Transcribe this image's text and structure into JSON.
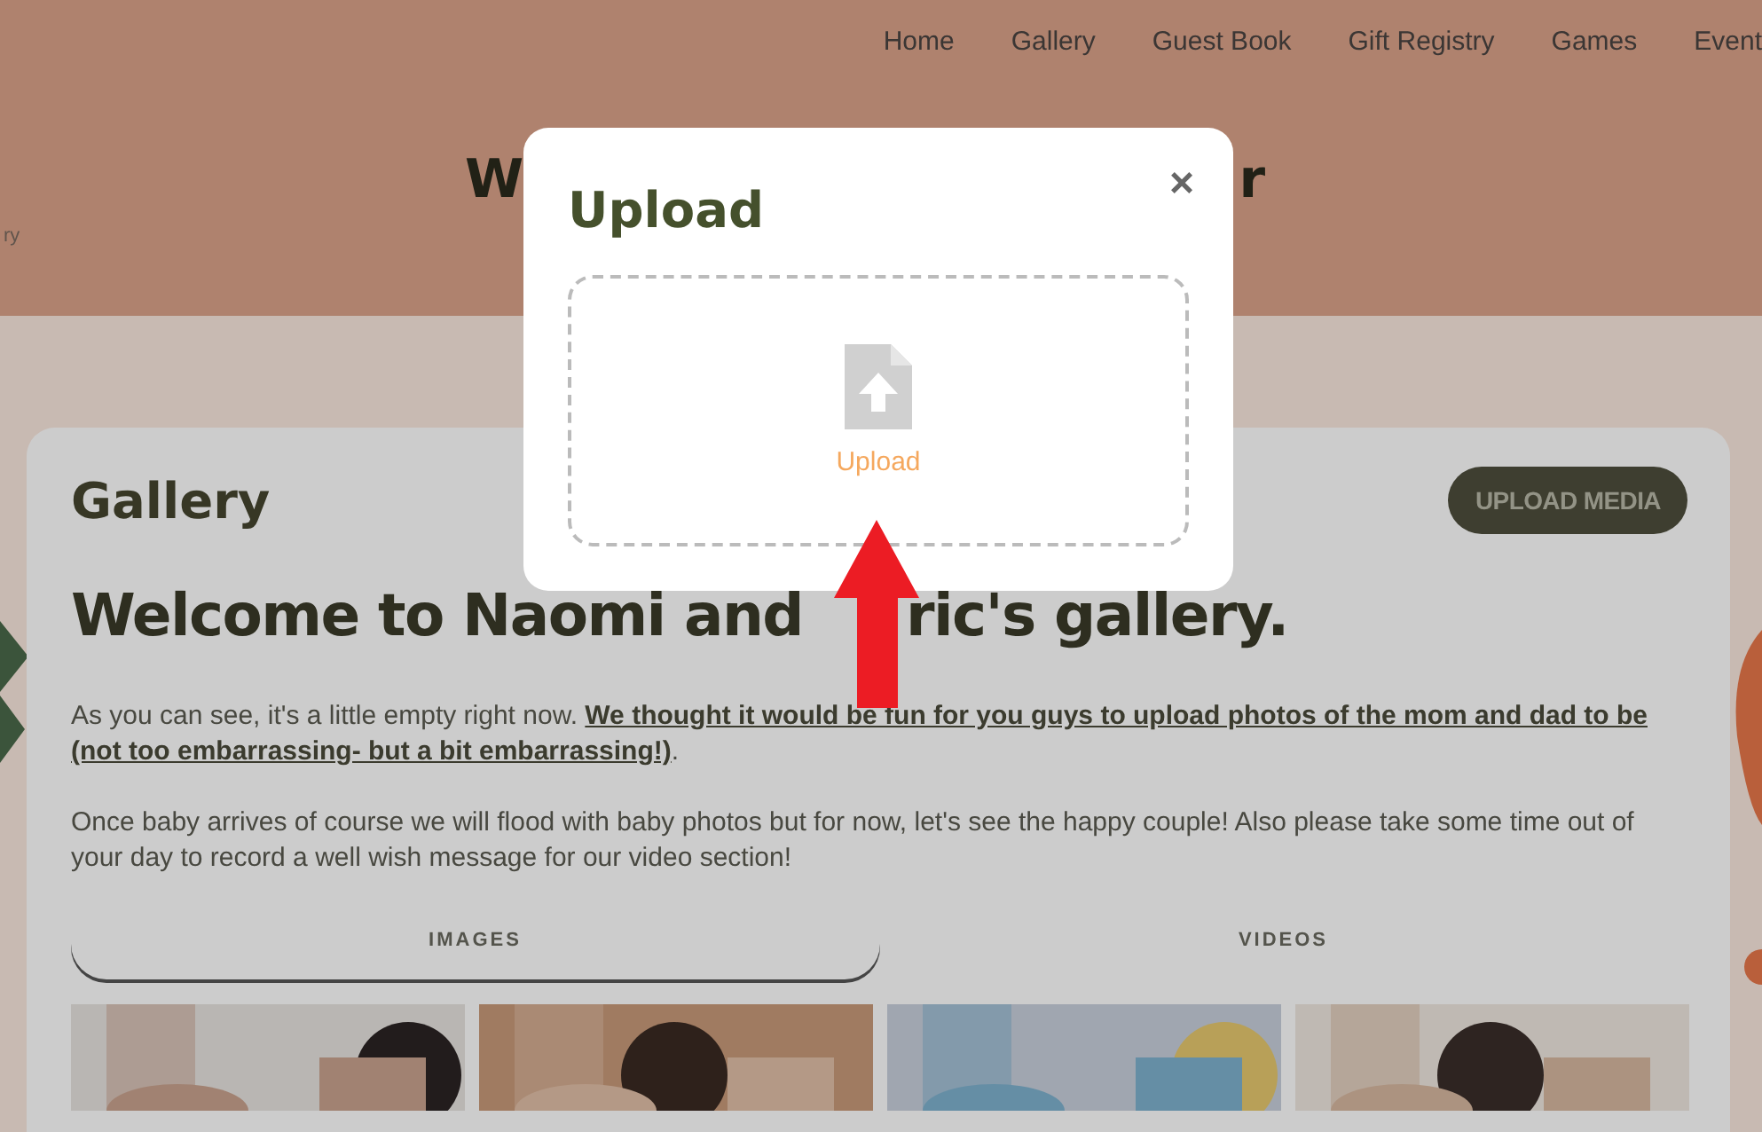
{
  "nav": [
    {
      "label": "Home"
    },
    {
      "label": "Gallery"
    },
    {
      "label": "Guest Book"
    },
    {
      "label": "Gift Registry"
    },
    {
      "label": "Games"
    },
    {
      "label": "Event"
    }
  ],
  "hero": {
    "title_start": "W",
    "title_end": "r",
    "crumb": "ry"
  },
  "gallery": {
    "title": "Gallery",
    "upload_button": "UPLOAD MEDIA",
    "heading_start": "Welcome to Naomi and",
    "heading_end": "ric's gallery.",
    "paragraphs": [
      "As you can see, it's a little empty right now. **We thought it would be fun for you guys to upload photos of the mom and dad to be (not too embarrassing- but a bit embarrassing!)**.",
      "Once baby arrives of course we will flood with baby photos but for now, let's see the happy couple! Also please take some time out of your day to record a well wish message for our video section!"
    ],
    "tabs": [
      {
        "label": "IMAGES",
        "selected": true
      },
      {
        "label": "VIDEOS",
        "selected": false
      }
    ]
  },
  "modal": {
    "title": "Upload",
    "close": "×",
    "dropzone_label": "Upload"
  }
}
